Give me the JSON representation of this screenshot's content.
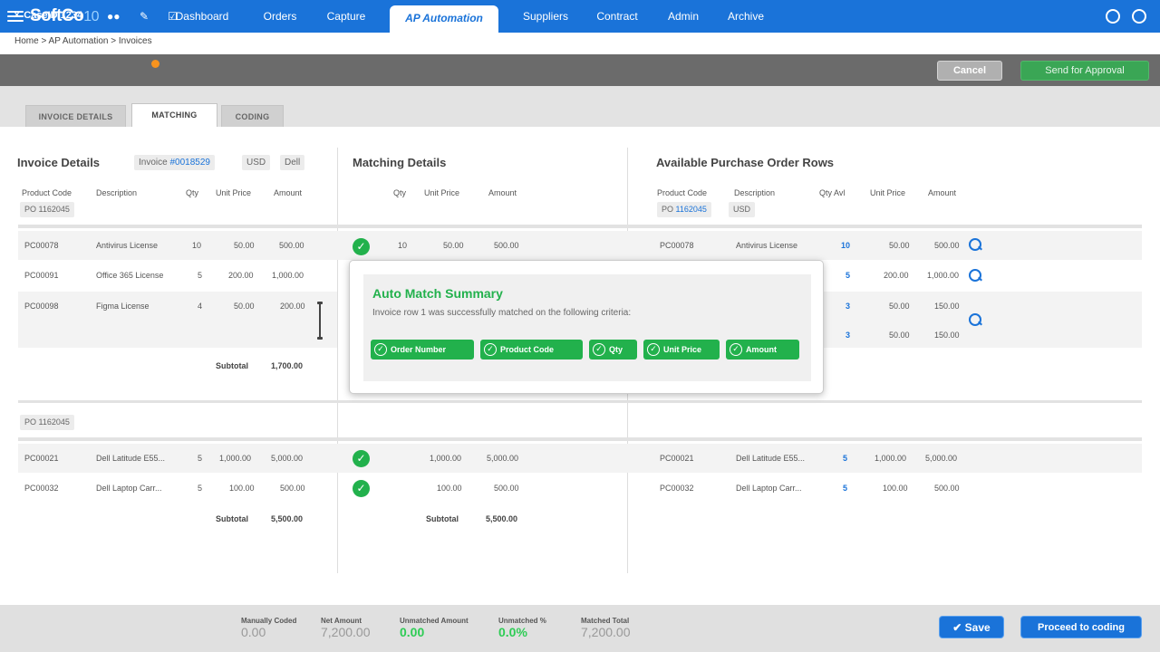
{
  "brand": {
    "name": "SoftCo",
    "version": "10"
  },
  "nav": {
    "items": [
      "Dashboard",
      "Orders",
      "Capture",
      "AP Automation",
      "Suppliers",
      "Contract",
      "Admin",
      "Archive"
    ],
    "active": "AP Automation"
  },
  "breadcrumb": "Home > AP Automation > Invoices",
  "casebar": {
    "case_id": "CaseID 1234",
    "cancel_label": "Cancel",
    "approve_label": "Send for Approval"
  },
  "tabs": [
    "INVOICE DETAILS",
    "MATCHING",
    "CODING"
  ],
  "invoice": {
    "title": "Invoice Details",
    "invoice_prefix": "Invoice ",
    "invoice_number": "#0018529",
    "currency": "USD",
    "vendor": "Dell",
    "headers": [
      "Product Code",
      "Description",
      "Qty",
      "Unit Price",
      "Amount"
    ],
    "po_label_1": "PO 1162045",
    "po_label_2": "PO 1162045",
    "group1_rows": [
      [
        "PC00078",
        "Antivirus License",
        "10",
        "50.00",
        "500.00"
      ],
      [
        "PC00091",
        "Office 365 License",
        "5",
        "200.00",
        "1,000.00"
      ],
      [
        "PC00098",
        "Figma License",
        "4",
        "50.00",
        "200.00"
      ]
    ],
    "group1_subtotal_label": "Subtotal",
    "group1_subtotal": "1,700.00",
    "group2_rows": [
      [
        "PC00021",
        "Dell Latitude E55...",
        "5",
        "1,000.00",
        "5,000.00"
      ],
      [
        "PC00032",
        "Dell Laptop Carr...",
        "5",
        "100.00",
        "500.00"
      ]
    ],
    "group2_subtotal_label": "Subtotal",
    "group2_subtotal": "5,500.00"
  },
  "matching": {
    "title": "Matching Details",
    "headers": [
      "Qty",
      "Unit Price",
      "Amount"
    ],
    "row1": [
      "10",
      "50.00",
      "500.00"
    ],
    "group2_rows": [
      [
        "1,000.00",
        "5,000.00"
      ],
      [
        "100.00",
        "500.00"
      ]
    ],
    "subtotal_label": "Subtotal",
    "subtotal": "5,500.00"
  },
  "po_rows": {
    "title": "Available Purchase Order Rows",
    "headers": [
      "Product Code",
      "Description",
      "Qty Avl",
      "Unit Price",
      "Amount"
    ],
    "po_number_prefix": "PO ",
    "po_number": "1162045",
    "currency": "USD",
    "group1": [
      [
        "PC00078",
        "Antivirus License",
        "10",
        "50.00",
        "500.00"
      ],
      [
        "",
        "",
        "5",
        "200.00",
        "1,000.00"
      ],
      [
        "",
        "",
        "3",
        "50.00",
        "150.00"
      ],
      [
        "",
        "",
        "3",
        "50.00",
        "150.00"
      ]
    ],
    "group2": [
      [
        "PC00021",
        "Dell Latitude E55...",
        "5",
        "1,000.00",
        "5,000.00"
      ],
      [
        "PC00032",
        "Dell Laptop Carr...",
        "5",
        "100.00",
        "500.00"
      ]
    ]
  },
  "popup": {
    "title": "Auto Match Summary",
    "text": "Invoice row 1 was successfully matched on the following criteria:",
    "criteria": [
      "Order Number",
      "Product Code",
      "Qty",
      "Unit Price",
      "Amount"
    ]
  },
  "summary": [
    {
      "label": "Manually Coded",
      "value": "0.00",
      "color": "#999999"
    },
    {
      "label": "Net Amount",
      "value": "7,200.00",
      "color": "#999999"
    },
    {
      "label": "Unmatched Amount",
      "value": "0.00",
      "color": "#2ecc55"
    },
    {
      "label": "Unmatched %",
      "value": "0.0%",
      "color": "#2ecc55"
    },
    {
      "label": "Matched Total",
      "value": "7,200.00",
      "color": "#999999"
    }
  ],
  "actions": {
    "save_label": "Save",
    "proceed_label": "Proceed to coding"
  },
  "icons": {
    "menu": "hamburger-icon",
    "globe": "globe-icon",
    "power": "power-icon",
    "close": "close-icon",
    "check": "check-icon",
    "search": "magnifier-icon"
  },
  "colors": {
    "brand_blue": "#1a73d9",
    "match_green": "#22b14c",
    "casebar_gray": "#6b6b6b",
    "badge_orange": "#f7931e"
  }
}
